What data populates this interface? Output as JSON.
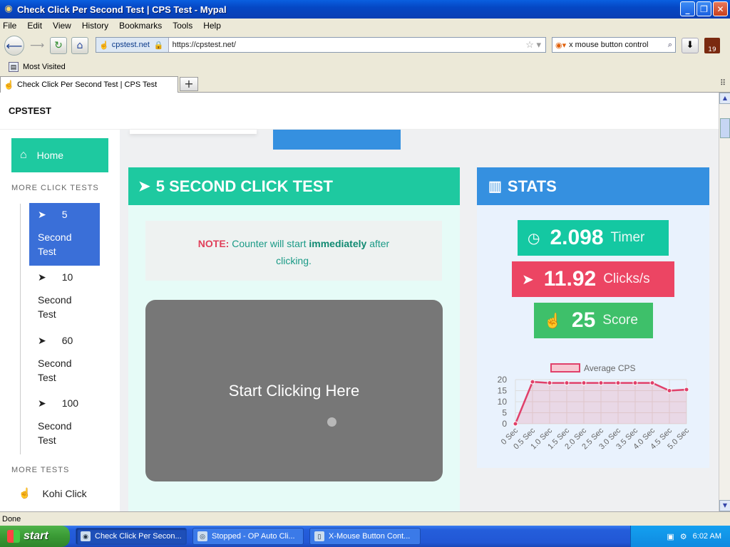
{
  "window": {
    "title": "Check Click Per Second Test | CPS Test - Mypal"
  },
  "menu": [
    "File",
    "Edit",
    "View",
    "History",
    "Bookmarks",
    "Tools",
    "Help"
  ],
  "url": {
    "site": "cpstest.net",
    "address": "https://cpstest.net/"
  },
  "search": {
    "value": "x mouse button control"
  },
  "addon": {
    "badge": "19"
  },
  "bookmarks": {
    "most_visited": "Most Visited"
  },
  "tab": {
    "title": "Check Click Per Second Test | CPS Test"
  },
  "status": {
    "text": "Done"
  },
  "taskbar": {
    "start": "start",
    "items": [
      {
        "label": "Check Click Per Secon..."
      },
      {
        "label": "Stopped - OP Auto Cli..."
      },
      {
        "label": "X-Mouse Button Cont..."
      }
    ],
    "clock": "6:02 AM"
  },
  "page": {
    "brand": "CPSTEST",
    "sidebar": {
      "home": "Home",
      "more_click_tests": "MORE CLICK TESTS",
      "items": [
        {
          "num": "5",
          "label1": "Second",
          "label2": "Test"
        },
        {
          "num": "10",
          "label1": "Second",
          "label2": "Test"
        },
        {
          "num": "60",
          "label1": "Second",
          "label2": "Test"
        },
        {
          "num": "100",
          "label1": "Second",
          "label2": "Test"
        }
      ],
      "more_tests": "MORE TESTS",
      "kohi": "Kohi Click"
    },
    "click_card": {
      "title": "5 SECOND CLICK TEST",
      "note_key": "NOTE:",
      "note_pre": "Counter will start",
      "note_bold": "immediately",
      "note_post": "after",
      "note_line2": "clicking.",
      "start": "Start Clicking Here"
    },
    "stats": {
      "title": "STATS",
      "timer_value": "2.098",
      "timer_label": "Timer",
      "clicks_value": "11.92",
      "clicks_label": "Clicks/s",
      "score_value": "25",
      "score_label": "Score"
    }
  },
  "colors": {
    "teal": "#1ec9a0",
    "blue": "#3590e0",
    "red": "#ec4563",
    "green": "#3ec06a"
  },
  "chart_data": {
    "type": "line",
    "legend": "Average CPS",
    "categories": [
      "0 Sec",
      "0.5 Sec",
      "1.0 Sec",
      "1.5 Sec",
      "2.0 Sec",
      "2.5 Sec",
      "3.0 Sec",
      "3.5 Sec",
      "4.0 Sec",
      "4.5 Sec",
      "5.0 Sec"
    ],
    "values": [
      0,
      19,
      18.5,
      18.5,
      18.5,
      18.5,
      18.5,
      18.5,
      18.5,
      15,
      15.5
    ],
    "yticks": [
      "20",
      "15",
      "10",
      "5",
      "0"
    ],
    "ylim": [
      0,
      20
    ],
    "grid": true
  }
}
